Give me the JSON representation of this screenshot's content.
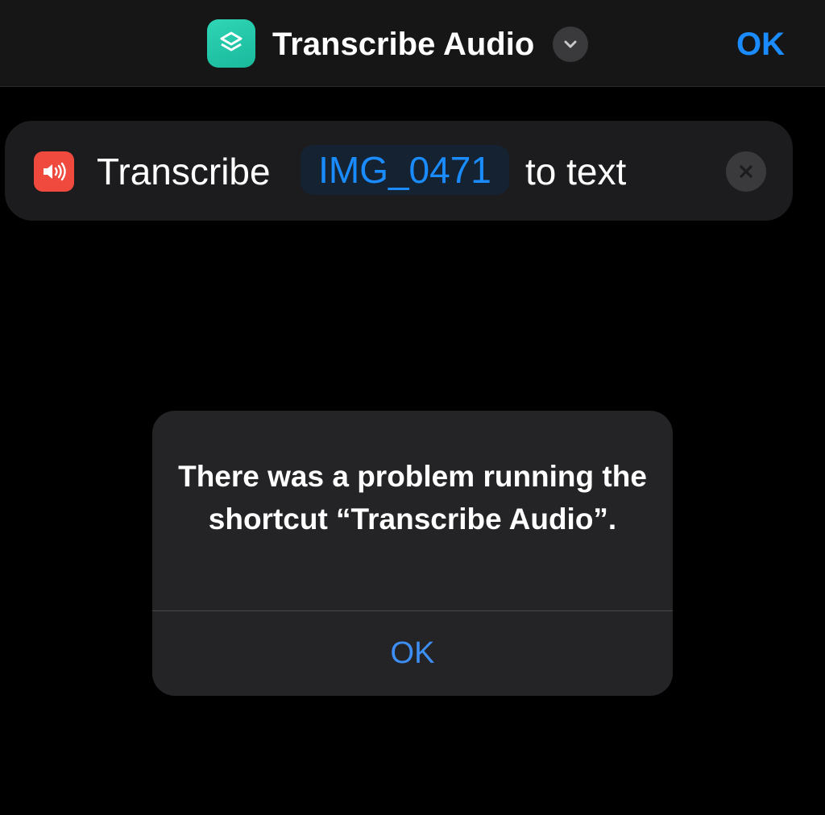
{
  "navbar": {
    "app_icon": "shortcuts-layers-icon",
    "title": "Transcribe Audio",
    "title_menu_icon": "chevron-down-icon",
    "done_label": "OK"
  },
  "action": {
    "icon": "speaker-wave-icon",
    "verb": "Transcribe",
    "variable": "IMG_0471",
    "suffix": "to text",
    "clear_icon": "close-icon"
  },
  "alert": {
    "message": "There was a problem running the shortcut “Transcribe Audio”.",
    "button_label": "OK"
  },
  "colors": {
    "accent": "#1a8cff",
    "app_icon_bg": "#19b89c",
    "speaker_icon_bg": "#ef4a3d",
    "background": "#000000",
    "card_bg": "#1c1c1e",
    "alert_bg": "#242426"
  }
}
